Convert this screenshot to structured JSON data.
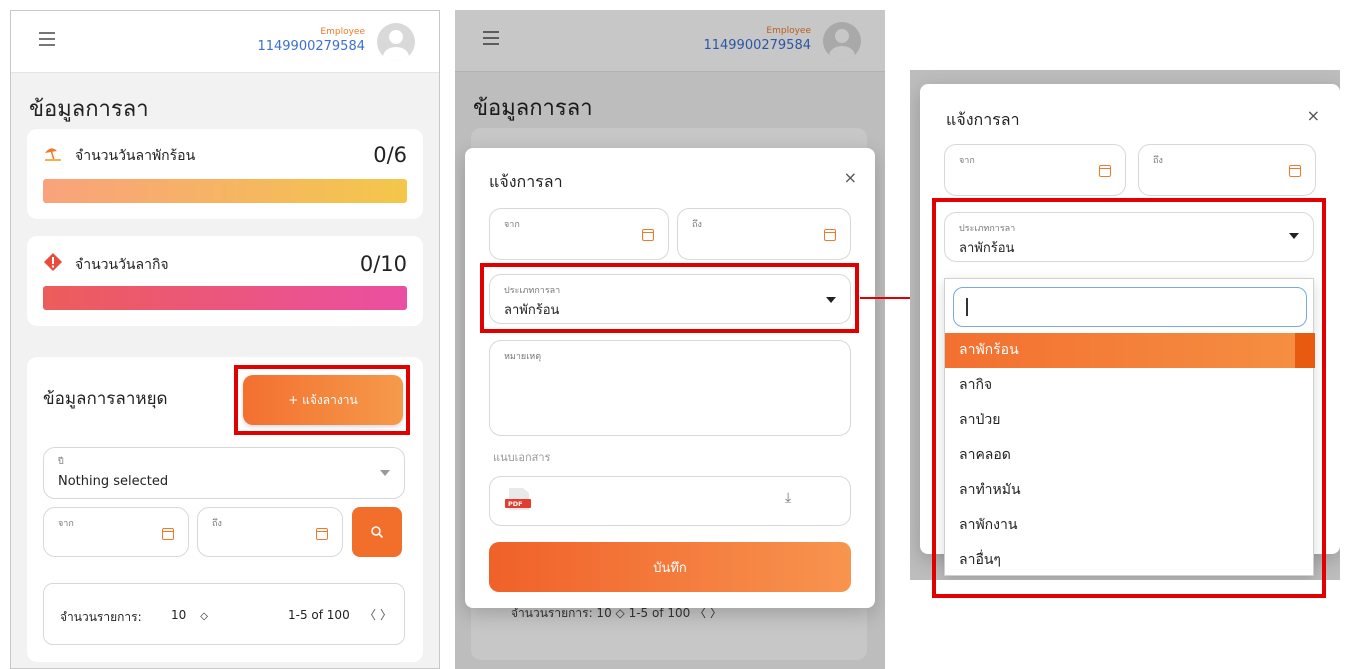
{
  "header": {
    "role": "Employee",
    "employee_id": "1149900279584"
  },
  "page_title": "ข้อมูลการลา",
  "summary_cards": [
    {
      "label": "จำนวนวันลาพักร้อน",
      "value": "0/6"
    },
    {
      "label": "จำนวนวันลากิจ",
      "value": "0/10"
    }
  ],
  "leave_history": {
    "title": "ข้อมูลการลาหยุด",
    "add_button_label": "+ แจ้งลางาน",
    "year_label": "ปี",
    "year_value": "Nothing selected",
    "from_label": "จาก",
    "to_label": "ถึง",
    "page_size_label": "จำนวนรายการ:",
    "page_size": "10",
    "pagination": "1-5 of 100",
    "peek_row": "จำนวนรายการ:   10  ◇              1-5 of 100 〈 〉"
  },
  "modal": {
    "title": "แจ้งการลา",
    "close": "×",
    "from_label": "จาก",
    "to_label": "ถึง",
    "type_label": "ประเภทการลา",
    "type_value": "ลาพักร้อน",
    "note_label": "หมายเหตุ",
    "attachment_label": "แนบเอกสาร",
    "pdf_badge": "PDF",
    "save_label": "บันทึก"
  },
  "dropdown": {
    "options": [
      "ลาพักร้อน",
      "ลากิจ",
      "ลาป่วย",
      "ลาคลอด",
      "ลาทำหมัน",
      "ลาพักงาน",
      "ลาอื่นๆ"
    ],
    "selected_index": 0
  },
  "colors": {
    "accent": "#f26e2b",
    "highlight": "#e00000",
    "link": "#3b6fd6"
  }
}
